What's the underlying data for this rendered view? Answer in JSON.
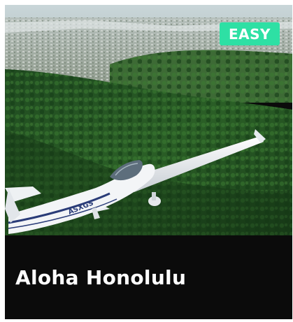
{
  "activity_card": {
    "difficulty_badge": "EASY",
    "title": "Aloha Honolulu",
    "aircraft_registration": "ASXGS",
    "badge_color": "#2ee0a4"
  }
}
